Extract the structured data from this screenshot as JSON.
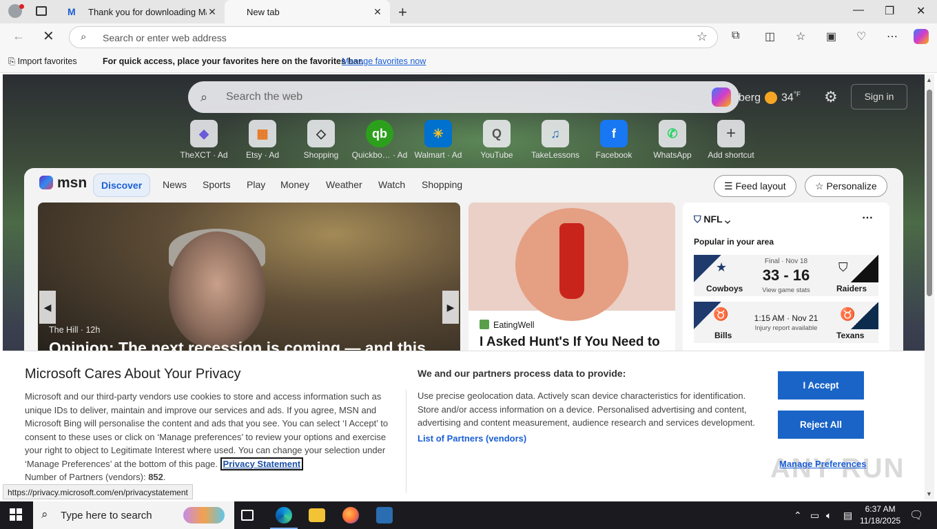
{
  "browser": {
    "tabs": [
      {
        "title": "Thank you for downloading Malw",
        "active": false
      },
      {
        "title": "New tab",
        "active": true
      }
    ],
    "address_placeholder": "Search or enter web address",
    "favorites_bar": {
      "import": "Import favorites",
      "hint": "For quick access, place your favorites here on the favorites bar.",
      "manage_link": "Manage favorites now"
    }
  },
  "newtab": {
    "search_placeholder": "Search the web",
    "weather": {
      "location": "berg",
      "temp": "34",
      "unit": "°F"
    },
    "sign_in": "Sign in",
    "shortcuts": [
      {
        "label": "TheXCT · Ad",
        "glyph": "◆"
      },
      {
        "label": "Etsy · Ad",
        "glyph": "▦"
      },
      {
        "label": "Shopping",
        "glyph": "◇"
      },
      {
        "label": "Quickbo… · Ad",
        "glyph": "qb"
      },
      {
        "label": "Walmart · Ad",
        "glyph": "✳"
      },
      {
        "label": "YouTube",
        "glyph": "Q"
      },
      {
        "label": "TakeLessons",
        "glyph": "♫"
      },
      {
        "label": "Facebook",
        "glyph": "f"
      },
      {
        "label": "WhatsApp",
        "glyph": "✆"
      },
      {
        "label": "Add shortcut",
        "glyph": "+"
      }
    ]
  },
  "msn": {
    "logo": "msn",
    "nav": [
      "Discover",
      "News",
      "Sports",
      "Play",
      "Money",
      "Weather",
      "Watch",
      "Shopping"
    ],
    "feed_layout": "Feed layout",
    "personalize": "Personalize",
    "hero": {
      "source": "The Hill · 12h",
      "headline": "Opinion: The next recession is coming — and this"
    },
    "card2": {
      "source": "EatingWell",
      "headline": "I Asked Hunt's If You Need to"
    },
    "nfl": {
      "title": "NFL",
      "popular": "Popular in your area",
      "games": [
        {
          "home": "Cowboys",
          "away": "Raiders",
          "status": "Final · Nov 18",
          "score": "33 - 16",
          "note": "View game stats"
        },
        {
          "home": "Bills",
          "away": "Texans",
          "status": "1:15 AM · Nov 21",
          "score": "",
          "note": "Injury report available"
        }
      ]
    }
  },
  "privacy": {
    "title": "Microsoft Cares About Your Privacy",
    "body": "Microsoft and our third-party vendors use cookies to store and access information such as unique IDs to deliver, maintain and improve our services and ads. If you agree, MSN and Microsoft Bing will personalise the content and ads that you see. You can select ‘I Accept’ to consent to these uses or click on ‘Manage preferences’ to review your options and exercise your right to object to Legitimate Interest where used.  You can change your selection under ‘Manage Preferences’ at the bottom of this page.",
    "privacy_statement": "Privacy Statement",
    "partners_count_label": "Number of Partners (vendors):",
    "partners_count": "852",
    "data_heading": "We and our partners process data to provide:",
    "data_body": "Use precise geolocation data. Actively scan device characteristics for identification. Store and/or access information on a device. Personalised advertising and content, advertising and content measurement, audience research and services development.",
    "partners_link": "List of Partners (vendors)",
    "accept": "I Accept",
    "reject": "Reject All",
    "manage": "Manage Preferences"
  },
  "status_url": "https://privacy.microsoft.com/en/privacystatement",
  "watermark": "ANY RUN",
  "taskbar": {
    "search_placeholder": "Type here to search",
    "time": "6:37 AM",
    "date": "11/18/2025"
  },
  "colors": {
    "accent": "#1a64c8",
    "link": "#1a5fd6",
    "taskbar": "#1b1b1f"
  }
}
